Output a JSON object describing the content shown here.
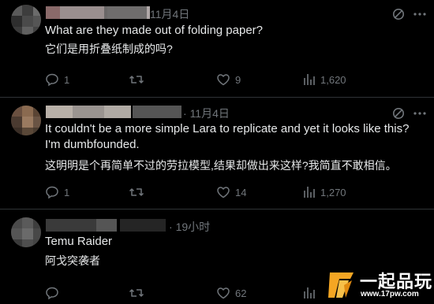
{
  "posts": [
    {
      "time": "11月4日",
      "text_en": "What are they made out of folding paper?",
      "text_zh": "它们是用折叠纸制成的吗?",
      "stats": {
        "replies": "1",
        "reposts": "",
        "likes": "9",
        "views": "1,620"
      }
    },
    {
      "time": "11月4日",
      "text_en": "It couldn't be a more simple Lara to replicate and yet it looks like this? I'm dumbfounded.",
      "text_zh": "这明明是个再简单不过的劳拉模型,结果却做出来这样?我简直不敢相信。",
      "stats": {
        "replies": "1",
        "reposts": "",
        "likes": "14",
        "views": "1,270"
      }
    },
    {
      "time": "19小时",
      "text_en": "Temu Raider",
      "text_zh": "阿戈突袭者",
      "stats": {
        "replies": "",
        "reposts": "",
        "likes": "62",
        "views": ""
      }
    }
  ],
  "watermark": {
    "title": "一起品玩",
    "url": "www.17pw.com"
  },
  "icons": {
    "reply": "reply-icon",
    "repost": "repost-icon",
    "like": "heart-icon",
    "views": "views-icon",
    "grok": "grok-icon",
    "more": "more-icon"
  },
  "colors": {
    "background": "#000000",
    "text": "#e7e9ea",
    "muted": "#71767b",
    "divider": "#2f3336",
    "watermark_accent": "#f5a623"
  }
}
